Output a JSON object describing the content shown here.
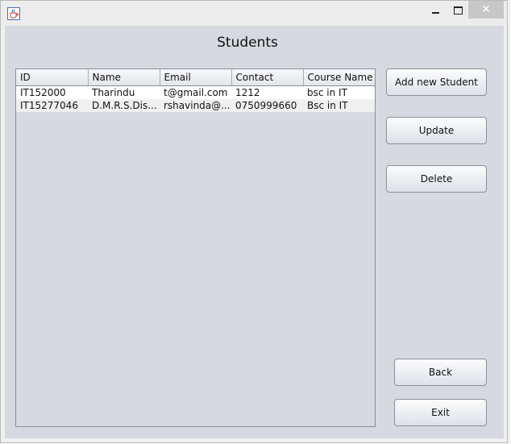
{
  "window": {
    "title": "",
    "icons": {
      "app": "java-cup-icon",
      "minimize": "minimize-icon",
      "maximize": "maximize-icon",
      "close": "close-icon"
    },
    "close_symbol": "✕"
  },
  "page": {
    "heading": "Students"
  },
  "table": {
    "columns": [
      "ID",
      "Name",
      "Email",
      "Contact",
      "Course Name"
    ],
    "rows": [
      [
        "IT152000",
        "Tharindu",
        "t@gmail.com",
        "1212",
        "bsc in IT"
      ],
      [
        "IT15277046",
        "D.M.R.S.Dis...",
        "rshavinda@...",
        "0750999660",
        "Bsc in IT"
      ]
    ]
  },
  "buttons": {
    "add": "Add new Student",
    "update": "Update",
    "delete": "Delete",
    "back": "Back",
    "exit": "Exit"
  },
  "colors": {
    "panel": "#d6d9df",
    "close_button": "#c7c7c7"
  }
}
